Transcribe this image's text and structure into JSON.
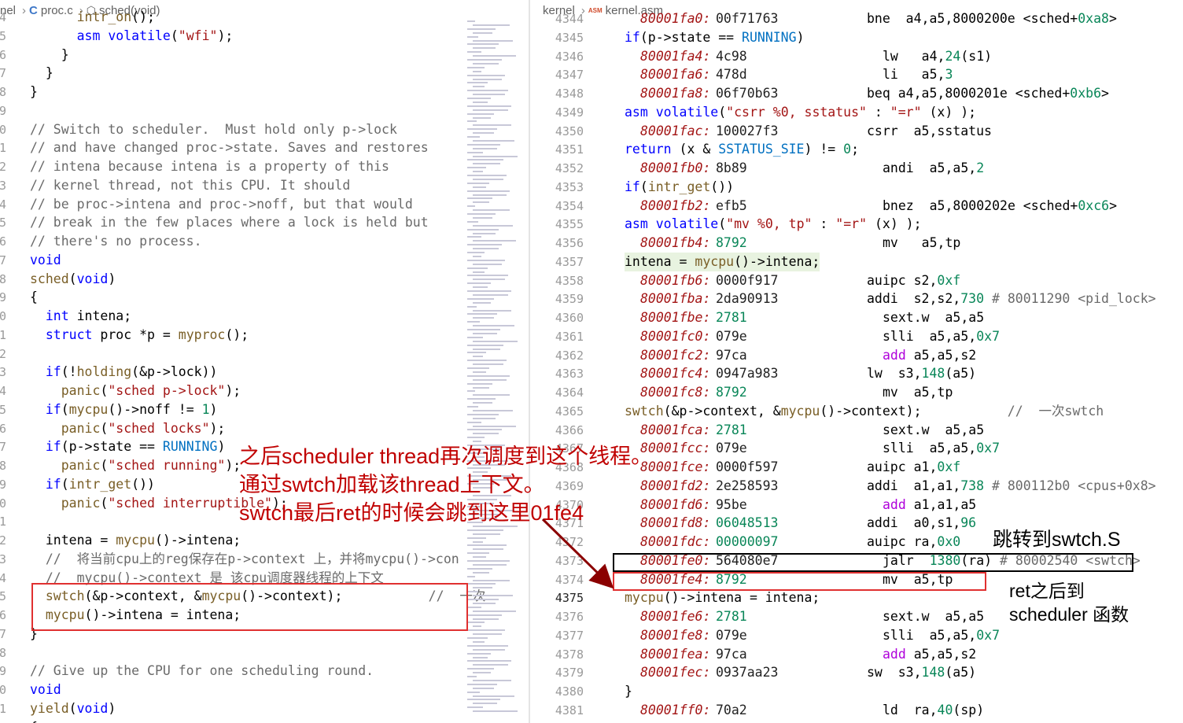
{
  "left": {
    "breadcrumb": [
      "nel",
      "proc.c",
      "sched(void)"
    ],
    "line_numbers": [
      "4",
      "5",
      "6",
      "7",
      "8",
      "9",
      "0",
      "1",
      "2",
      "3",
      "4",
      "5",
      "6",
      "7",
      "8",
      "9",
      "0",
      "1",
      "2",
      "3",
      "4",
      "5",
      "6",
      "7",
      "8",
      "9",
      "0",
      "1",
      "2",
      "3",
      "4",
      "5",
      "6",
      "7",
      "8",
      "9",
      "0",
      "1",
      "2"
    ],
    "lines": [
      "      intr_on();",
      "      asm volatile(\"wfi\");",
      "    }",
      "  }",
      "}",
      "",
      "// Switch to scheduler.  Must hold only p->lock",
      "// and have changed proc->state. Saves and restores",
      "// intena because intena is a property of this",
      "// kernel thread, not this CPU. It should",
      "// be proc->intena and proc->noff, but that would",
      "// break in the few places where a lock is held but",
      "// there's no process.",
      "void",
      "sched(void)",
      "{",
      "  int intena;",
      "  struct proc *p = myproc();",
      "",
      "  if(!holding(&p->lock))",
      "    panic(\"sched p->lock\");",
      "  if(mycpu()->noff != 1)",
      "    panic(\"sched locks\");",
      "  if(p->state == RUNNING)",
      "    panic(\"sched running\");",
      "  if(intr_get())",
      "    panic(\"sched interruptible\");",
      "",
      "  intena = mycpu()->intena;",
      "  //  将当前cpu上的reg保存在p->context 上，并将mycpu()->con",
      "  //  mycpu()->context 是 该cpu调度器线程的上下文",
      "  swtch(&p->context, &mycpu()->context);           //  一次",
      "  mycpu()->intena = intena;",
      "}",
      "",
      "// Give up the CPU for one scheduling round.",
      "void",
      "yield(void)",
      "{"
    ]
  },
  "right": {
    "breadcrumb": [
      "kernel",
      "kernel.asm"
    ],
    "asm_icon": "ASM",
    "rows": [
      {
        "num": "4344",
        "src": "",
        "addr": "80001fa0:",
        "hex": "00f71763",
        "ins": "bne  a4,a5,8000200e <sched+0xa8>"
      },
      {
        "num": "4345",
        "src": "if(p->state == RUNNING)"
      },
      {
        "num": "4346",
        "addr": "80001fa4:",
        "hex": "4c98",
        "ins": "lw   a4,24(s1)"
      },
      {
        "num": "4347",
        "addr": "80001fa6:",
        "hex": "478d",
        "ins": "li   a5,3"
      },
      {
        "num": "4348",
        "addr": "80001fa8:",
        "hex": "06f70b63",
        "ins": "beq a4,a5,8000201e <sched+0xb6>"
      },
      {
        "num": "4349",
        "src": "asm volatile(\"csrr %0, sstatus\" : \"=r\" (x) );"
      },
      {
        "num": "4350",
        "addr": "80001fac:",
        "hex": "100027f3",
        "ins": "csrr  a5,sstatus"
      },
      {
        "num": "4351",
        "src": "return (x & SSTATUS_SIE) != 0;"
      },
      {
        "num": "4352",
        "addr": "80001fb0:",
        "hex": "8b89",
        "ins": "andi  a5,a5,2"
      },
      {
        "num": "4353",
        "src": "if(intr_get())"
      },
      {
        "num": "4354",
        "addr": "80001fb2:",
        "hex": "efb5",
        "ins": "bnez  a5,8000202e <sched+0xc6>"
      },
      {
        "num": "4355",
        "src": "asm volatile(\"mv %0, tp\" : \"=r\" (x) );"
      },
      {
        "num": "4356",
        "addr": "80001fb4:",
        "hex": "8792",
        "ins": "mv   a5,tp"
      },
      {
        "num": "4357",
        "src": "intena = mycpu()->intena;"
      },
      {
        "num": "4358",
        "addr": "80001fb6:",
        "hex": "0000f917",
        "ins": "auipc s2,0xf"
      },
      {
        "num": "4359",
        "addr": "80001fba:",
        "hex": "2da90913",
        "ins": "addi  s2,s2,730 # 80011290 <pid_lock>"
      },
      {
        "num": "4360",
        "addr": "80001fbe:",
        "hex": "2781",
        "ins": "sext.w  a5,a5"
      },
      {
        "num": "4361",
        "addr": "80001fc0:",
        "hex": "079e",
        "ins": "slli  a5,a5,0x7"
      },
      {
        "num": "4362",
        "addr": "80001fc2:",
        "hex": "97ca",
        "ins": "add a5,a5,s2"
      },
      {
        "num": "4363",
        "addr": "80001fc4:",
        "hex": "0947a983",
        "ins": "lw  s3,148(a5)"
      },
      {
        "num": "4364",
        "addr": "80001fc8:",
        "hex": "8792",
        "ins": "mv  a5,tp"
      },
      {
        "num": "4365",
        "src": "swtch(&p->context, &mycpu()->context);           //  一次swtch"
      },
      {
        "num": "4366",
        "addr": "80001fca:",
        "hex": "2781",
        "ins": "sext.w  a5,a5"
      },
      {
        "num": "4367",
        "addr": "80001fcc:",
        "hex": "079e",
        "ins": "slli  a5,a5,0x7"
      },
      {
        "num": "4368",
        "addr": "80001fce:",
        "hex": "0000f597",
        "ins": "auipc a1,0xf"
      },
      {
        "num": "4369",
        "addr": "80001fd2:",
        "hex": "2e258593",
        "ins": "addi  a1,a1,738 # 800112b0 <cpus+0x8>"
      },
      {
        "num": "4370",
        "addr": "80001fd6:",
        "hex": "95be",
        "ins": "add a1,a1,a5"
      },
      {
        "num": "4371",
        "addr": "80001fd8:",
        "hex": "06048513",
        "ins": "addi  a0,s1,96"
      },
      {
        "num": "4372",
        "addr": "80001fdc:",
        "hex": "00000097",
        "ins": "auipc ra,0x0"
      },
      {
        "num": "4373",
        "addr": "80001fe0:",
        "hex": "564080e7",
        "ins": "jalr  1380(ra) # 80002540 <swtch>"
      },
      {
        "num": "4374",
        "addr": "80001fe4:",
        "hex": "8792",
        "ins": "mv  a5,tp"
      },
      {
        "num": "4375",
        "src": "mycpu()->intena = intena;"
      },
      {
        "num": "4376",
        "addr": "80001fe6:",
        "hex": "2781",
        "ins": "sext.w  a5,a5"
      },
      {
        "num": "4377",
        "addr": "80001fe8:",
        "hex": "079e",
        "ins": "slli  a5,a5,0x7"
      },
      {
        "num": "4378",
        "addr": "80001fea:",
        "hex": "97ca",
        "ins": "add a5,a5,s2"
      },
      {
        "num": "4379",
        "addr": "80001fec:",
        "hex": "0937aa23",
        "ins": "sw  s3,148(a5)"
      },
      {
        "num": "4380",
        "src": "}"
      },
      {
        "num": "4381",
        "addr": "80001ff0:",
        "hex": "70a2",
        "ins": "ld  ra,40(sp)"
      }
    ]
  },
  "annotations": {
    "red_note_1": "之后scheduler thread再次调度到这个线程。",
    "red_note_2": "通过swtch加载该thread上下文。",
    "red_note_3": "swtch最后ret的时候会跳到这里01fe4",
    "label_jump": "跳转到swtch.S",
    "label_ret_1": "ret之后到",
    "label_ret_2": "scheduler 函数"
  },
  "colors": {
    "annotation_red": "#c00000",
    "box_red": "#e03030",
    "box_black": "#000000"
  }
}
